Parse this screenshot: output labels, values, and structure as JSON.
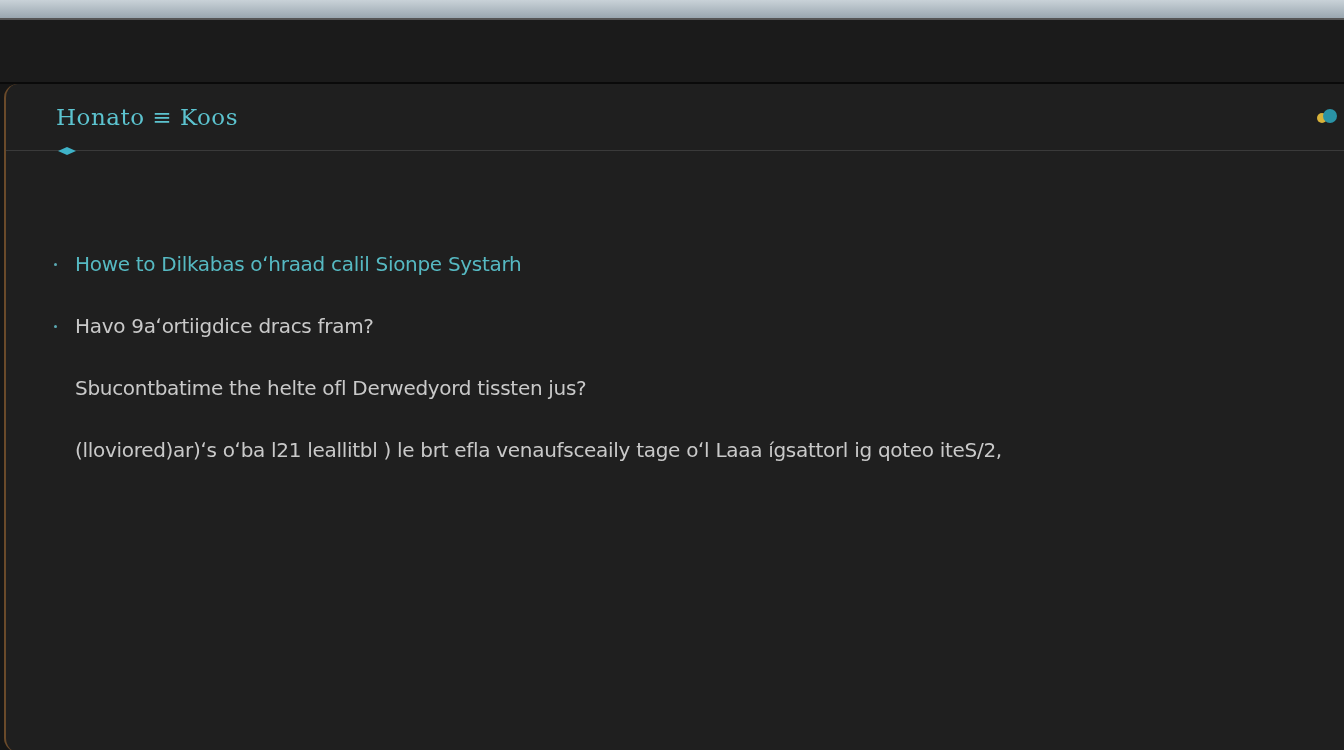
{
  "panel": {
    "title": "Honato ≡ Koos"
  },
  "lines": [
    {
      "kind": "link",
      "bullet": true,
      "text": "Howe to Dilkabas oʻhraad calil Sionpe Systarh"
    },
    {
      "kind": "text",
      "bullet": true,
      "text": "Havo 9aʻortiigdice dracs fram?"
    },
    {
      "kind": "text",
      "bullet": false,
      "text": "Sbucontbatime the helte ofl Derwedyord tissten jus?"
    },
    {
      "kind": "text",
      "bullet": false,
      "text": "(lloviored)ar)ʻs oʻba l21 leallitbl ) le brt efla venaufsceaily tage oʻl Laaa ígsattorl ig qoteo iteS/2,"
    }
  ]
}
